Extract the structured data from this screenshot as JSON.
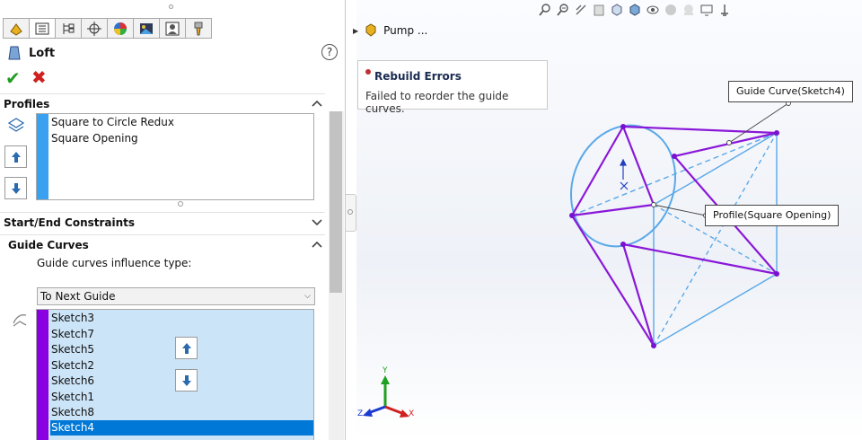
{
  "property_manager": {
    "feature_title": "Loft",
    "help_label": "?",
    "tabs": [
      "feature-manager",
      "property-manager",
      "configuration-manager",
      "dim-xpert",
      "display-manager",
      "appearance",
      "cam"
    ],
    "profiles": {
      "header": "Profiles",
      "items": [
        "Square to Circle Redux",
        "Square Opening"
      ],
      "bar_color": "#3aa0f0"
    },
    "start_end": {
      "header": "Start/End Constraints"
    },
    "guide_curves": {
      "header": "Guide Curves",
      "influence_label": "Guide curves influence type:",
      "influence_value": "To Next Guide",
      "items": [
        "Sketch3",
        "Sketch7",
        "Sketch5",
        "Sketch2",
        "Sketch6",
        "Sketch1",
        "Sketch8",
        "Sketch4"
      ],
      "selected_index": 7,
      "bar_color": "#8a00e0",
      "list_bg": "#cce4f7"
    }
  },
  "viewport": {
    "tree_label": "Pump ...",
    "error": {
      "title": "Rebuild Errors",
      "message": "Failed to reorder the guide curves."
    },
    "callouts": {
      "guide": "Guide Curve(Sketch4)",
      "profile": "Profile(Square Opening)"
    },
    "triad": {
      "x": "X",
      "y": "Y",
      "z": "Z"
    },
    "colors": {
      "profile": "#5aa8e8",
      "guide": "#8a18d8"
    }
  }
}
